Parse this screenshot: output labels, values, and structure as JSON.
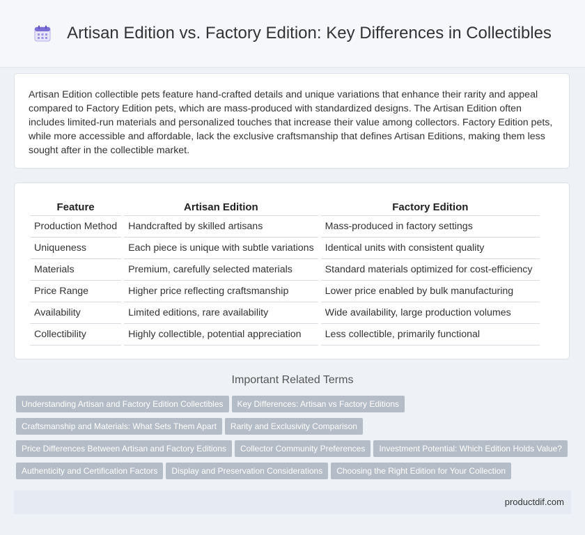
{
  "header": {
    "title": "Artisan Edition vs. Factory Edition: Key Differences in Collectibles",
    "icon": "calendar-icon"
  },
  "intro": {
    "text": "Artisan Edition collectible pets feature hand-crafted details and unique variations that enhance their rarity and appeal compared to Factory Edition pets, which are mass-produced with standardized designs. The Artisan Edition often includes limited-run materials and personalized touches that increase their value among collectors. Factory Edition pets, while more accessible and affordable, lack the exclusive craftsmanship that defines Artisan Editions, making them less sought after in the collectible market."
  },
  "table": {
    "headers": [
      "Feature",
      "Artisan Edition",
      "Factory Edition"
    ],
    "rows": [
      [
        "Production Method",
        "Handcrafted by skilled artisans",
        "Mass-produced in factory settings"
      ],
      [
        "Uniqueness",
        "Each piece is unique with subtle variations",
        "Identical units with consistent quality"
      ],
      [
        "Materials",
        "Premium, carefully selected materials",
        "Standard materials optimized for cost-efficiency"
      ],
      [
        "Price Range",
        "Higher price reflecting craftsmanship",
        "Lower price enabled by bulk manufacturing"
      ],
      [
        "Availability",
        "Limited editions, rare availability",
        "Wide availability, large production volumes"
      ],
      [
        "Collectibility",
        "Highly collectible, potential appreciation",
        "Less collectible, primarily functional"
      ]
    ]
  },
  "related": {
    "title": "Important Related Terms",
    "tags": [
      "Understanding Artisan and Factory Edition Collectibles",
      "Key Differences: Artisan vs Factory Editions",
      "Craftsmanship and Materials: What Sets Them Apart",
      "Rarity and Exclusivity Comparison",
      "Price Differences Between Artisan and Factory Editions",
      "Collector Community Preferences",
      "Investment Potential: Which Edition Holds Value?",
      "Authenticity and Certification Factors",
      "Display and Preservation Considerations",
      "Choosing the Right Edition for Your Collection"
    ]
  },
  "footer": {
    "text": "productdif.com"
  },
  "colors": {
    "tag_bg": "#b4bcc7",
    "page_bg": "#eef1f6",
    "icon_accent": "#7b6fd6"
  }
}
